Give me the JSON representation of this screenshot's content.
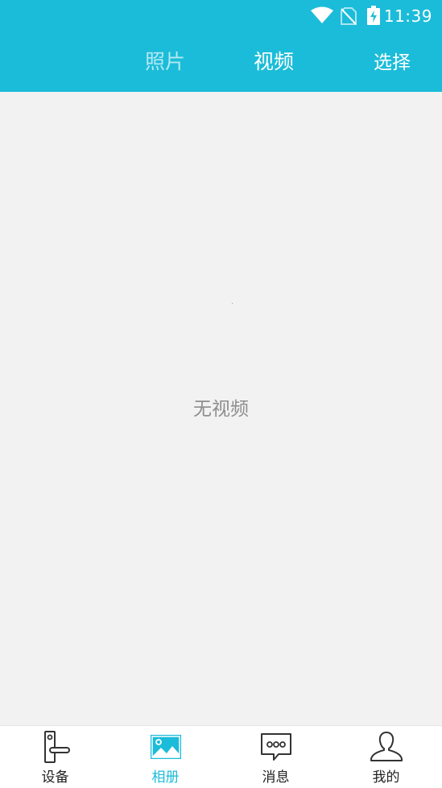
{
  "status": {
    "time": "11:39",
    "icons": [
      "wifi-icon",
      "no-sim-icon",
      "battery-charging-icon"
    ]
  },
  "header": {
    "tabs": [
      {
        "label": "照片",
        "active": false
      },
      {
        "label": "视频",
        "active": true
      }
    ],
    "select_label": "选择"
  },
  "main": {
    "empty_text": "无视频"
  },
  "bottom_nav": {
    "items": [
      {
        "label": "设备",
        "icon": "door-lock-icon",
        "active": false
      },
      {
        "label": "相册",
        "icon": "gallery-icon",
        "active": true
      },
      {
        "label": "消息",
        "icon": "message-icon",
        "active": false
      },
      {
        "label": "我的",
        "icon": "user-icon",
        "active": false
      }
    ]
  },
  "colors": {
    "accent": "#1bbcd9",
    "background": "#f2f2f2",
    "empty_text": "#8e8e8e"
  }
}
